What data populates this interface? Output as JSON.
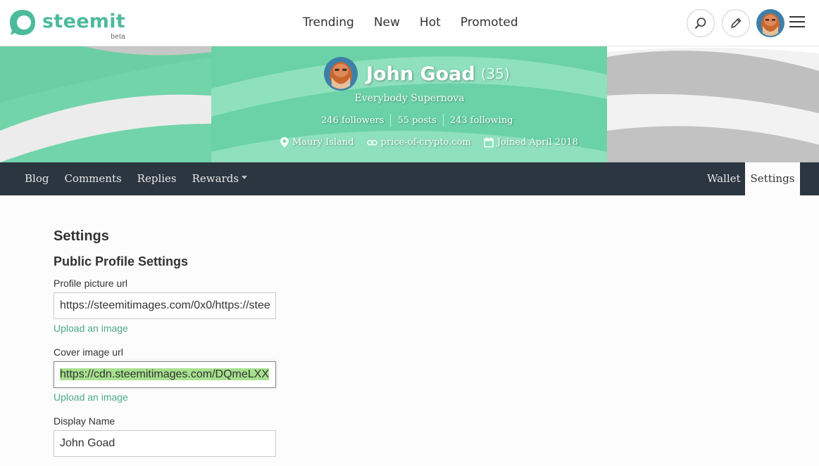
{
  "header": {
    "logo_text": "steemit",
    "logo_badge": "beta",
    "nav": [
      "Trending",
      "New",
      "Hot",
      "Promoted"
    ]
  },
  "profile": {
    "name": "John Goad",
    "reputation": "(35)",
    "about": "Everybody Supernova",
    "followers": "246 followers",
    "posts": "55 posts",
    "following": "243 following",
    "location": "Maury Island",
    "website": "price-of-crypto.com",
    "joined": "Joined April 2018"
  },
  "profile_nav": {
    "left": [
      "Blog",
      "Comments",
      "Replies",
      "Rewards"
    ],
    "wallet": "Wallet",
    "settings": "Settings"
  },
  "settings": {
    "title": "Settings",
    "section": "Public Profile Settings",
    "profile_picture_label": "Profile picture url",
    "profile_picture_value": "https://steemitimages.com/0x0/https://stee",
    "upload_1": "Upload an image",
    "cover_image_label": "Cover image url",
    "cover_image_value": "https://cdn.steemitimages.com/DQmeLXX",
    "upload_2": "Upload an image",
    "display_name_label": "Display Name",
    "display_name_value": "John Goad"
  },
  "colors": {
    "brand_blue": "#4ba2f2",
    "brand_green": "#4cbb9b",
    "cover_green": "#6dcfa6",
    "nav_dark": "#2c3640",
    "link_green": "#4ba888"
  }
}
